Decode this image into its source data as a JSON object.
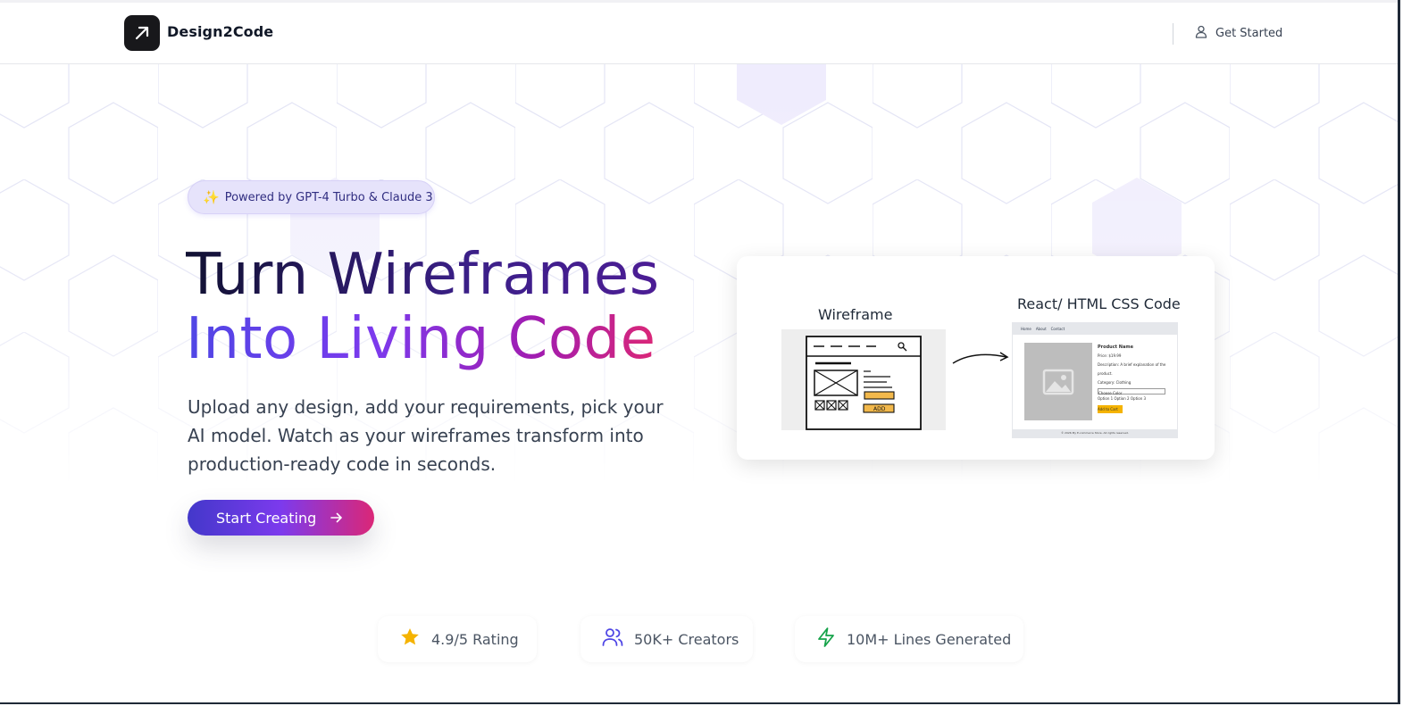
{
  "header": {
    "brand": "Design2Code",
    "get_started": "Get Started"
  },
  "hero": {
    "badge_icon": "sparkles-icon",
    "badge": "Powered by GPT-4 Turbo & Claude 3",
    "title_line1": "Turn Wireframes",
    "title_line2": "Into Living Code",
    "subtitle": "Upload any design, add your requirements, pick your AI model. Watch as your wireframes transform into production-ready code in seconds.",
    "cta": "Start Creating"
  },
  "illustration": {
    "wireframe_label": "Wireframe",
    "code_label": "React/ HTML CSS Code",
    "wireframe_button": "ADD",
    "nav_items": [
      "Home",
      "About",
      "Contact"
    ],
    "product_name": "Product Name",
    "price": "Price: $19.99",
    "description": "Description: A brief explanation of the product.",
    "category": "Category: Clothing",
    "select": "Choose Color",
    "options": "Option 1  Option 2  Option 3",
    "add_to_cart": "Add to Cart",
    "footer": "© 2026 My E-commerce Store. All rights reserved."
  },
  "stats": [
    {
      "icon": "star-icon",
      "label": "4.9/5 Rating",
      "color": "#f5b301"
    },
    {
      "icon": "users-icon",
      "label": "50K+ Creators",
      "color": "#4f46e5"
    },
    {
      "icon": "lightning-icon",
      "label": "10M+ Lines Generated",
      "color": "#16a34a"
    }
  ],
  "colors": {
    "gradient_start": "#4338ca",
    "gradient_mid": "#7c3aed",
    "gradient_end": "#db2777",
    "badge_bg": "#e6e3fb"
  }
}
